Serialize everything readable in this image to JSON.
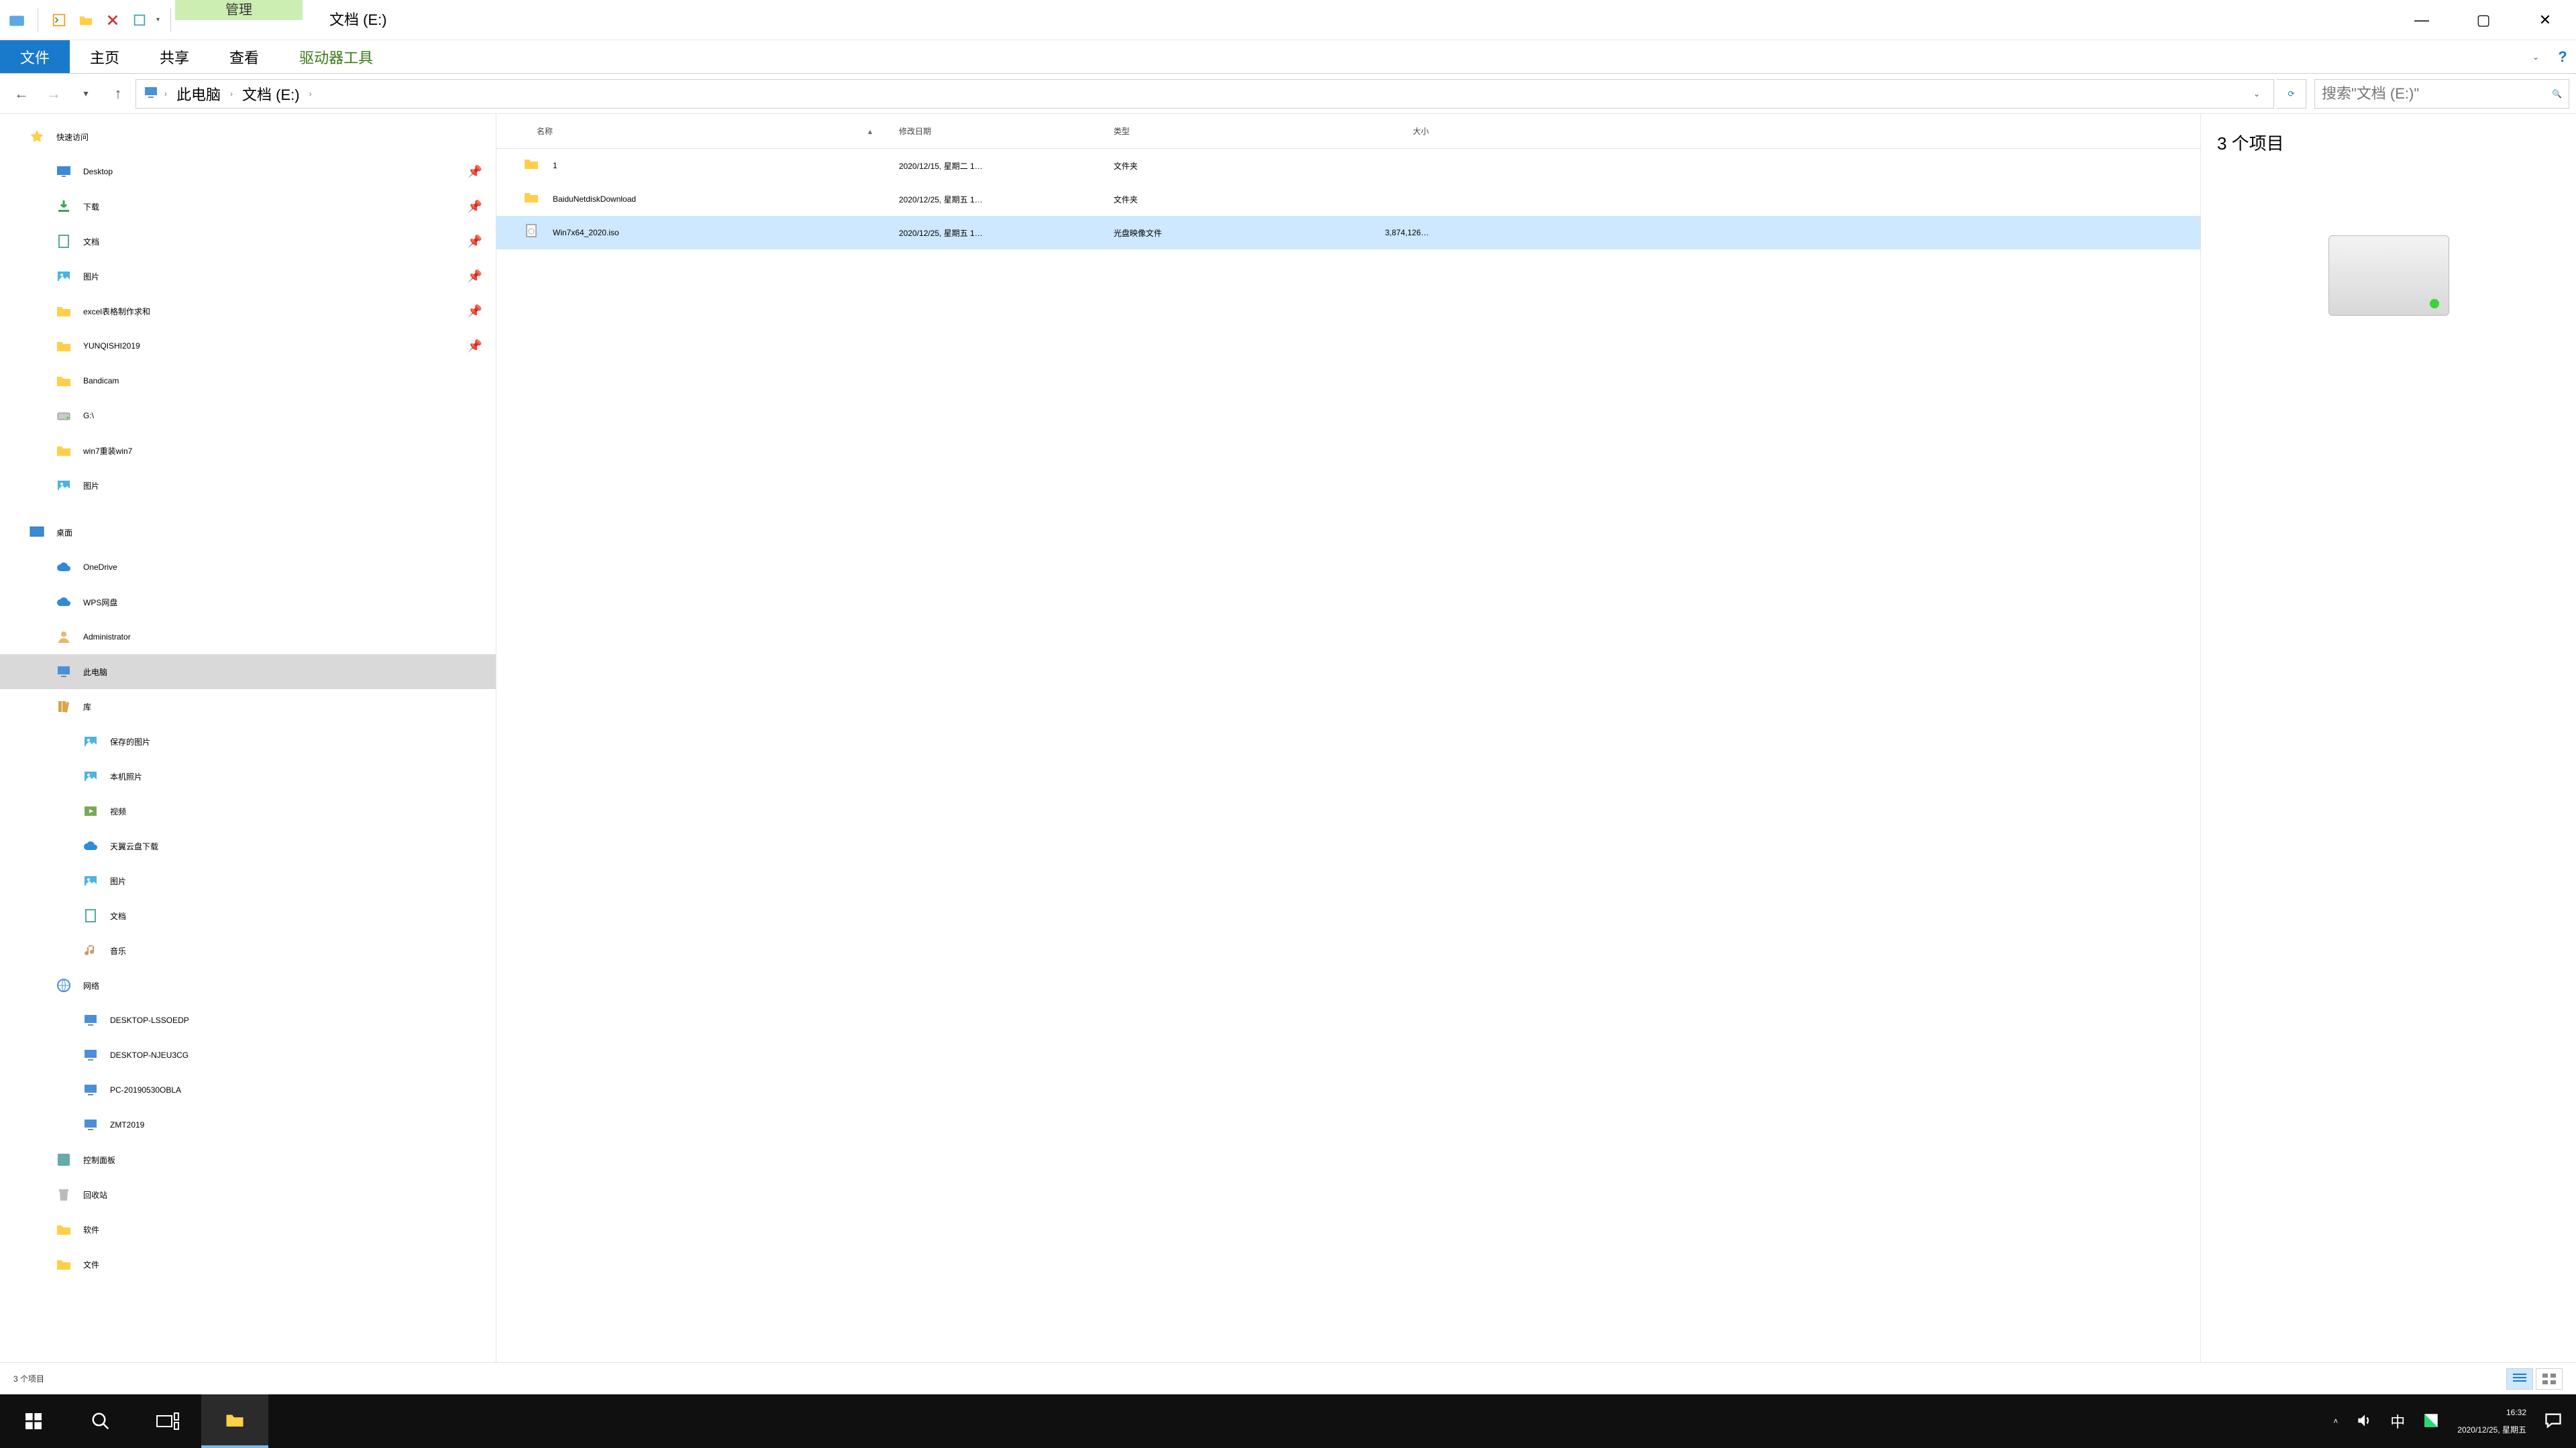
{
  "window": {
    "context_tab": "管理",
    "title": "文档 (E:)",
    "minimize": "—",
    "maximize": "▢",
    "close": "✕"
  },
  "ribbon": {
    "file": "文件",
    "tabs": [
      "主页",
      "共享",
      "查看"
    ],
    "context_tab": "驱动器工具",
    "help": "?"
  },
  "nav": {
    "crumbs": [
      "此电脑",
      "文档 (E:)"
    ],
    "refresh": "⟳"
  },
  "search": {
    "placeholder": "搜索\"文档 (E:)\""
  },
  "tree": {
    "quick_access": "快速访问",
    "quick": [
      {
        "label": "Desktop",
        "pinned": true,
        "icon": "desktop"
      },
      {
        "label": "下载",
        "pinned": true,
        "icon": "download"
      },
      {
        "label": "文档",
        "pinned": true,
        "icon": "doc"
      },
      {
        "label": "图片",
        "pinned": true,
        "icon": "pic"
      },
      {
        "label": "excel表格制作求和",
        "pinned": true,
        "icon": "folder"
      },
      {
        "label": "YUNQISHI2019",
        "pinned": true,
        "icon": "folder"
      },
      {
        "label": "Bandicam",
        "pinned": false,
        "icon": "folder"
      },
      {
        "label": "G:\\",
        "pinned": false,
        "icon": "drive"
      },
      {
        "label": "win7重装win7",
        "pinned": false,
        "icon": "folder"
      },
      {
        "label": "图片",
        "pinned": false,
        "icon": "pic"
      }
    ],
    "desktop": "桌面",
    "desktop_children": [
      {
        "label": "OneDrive",
        "icon": "cloud"
      },
      {
        "label": "WPS网盘",
        "icon": "cloud"
      },
      {
        "label": "Administrator",
        "icon": "user"
      },
      {
        "label": "此电脑",
        "icon": "pc",
        "selected": true
      },
      {
        "label": "库",
        "icon": "lib"
      },
      {
        "label": "保存的图片",
        "icon": "pic",
        "depth": 2
      },
      {
        "label": "本机照片",
        "icon": "pic",
        "depth": 2
      },
      {
        "label": "视频",
        "icon": "video",
        "depth": 2
      },
      {
        "label": "天翼云盘下载",
        "icon": "cloud",
        "depth": 2
      },
      {
        "label": "图片",
        "icon": "pic",
        "depth": 2
      },
      {
        "label": "文档",
        "icon": "doc",
        "depth": 2
      },
      {
        "label": "音乐",
        "icon": "music",
        "depth": 2
      },
      {
        "label": "网络",
        "icon": "net"
      },
      {
        "label": "DESKTOP-LSSOEDP",
        "icon": "pc",
        "depth": 2
      },
      {
        "label": "DESKTOP-NJEU3CG",
        "icon": "pc",
        "depth": 2
      },
      {
        "label": "PC-20190530OBLA",
        "icon": "pc",
        "depth": 2
      },
      {
        "label": "ZMT2019",
        "icon": "pc",
        "depth": 2
      },
      {
        "label": "控制面板",
        "icon": "ctrl"
      },
      {
        "label": "回收站",
        "icon": "bin"
      },
      {
        "label": "软件",
        "icon": "folder"
      },
      {
        "label": "文件",
        "icon": "folder"
      }
    ]
  },
  "columns": {
    "name": "名称",
    "date": "修改日期",
    "type": "类型",
    "size": "大小"
  },
  "rows": [
    {
      "name": "1",
      "date": "2020/12/15, 星期二 1…",
      "type": "文件夹",
      "size": "",
      "icon": "folder",
      "selected": false
    },
    {
      "name": "BaiduNetdiskDownload",
      "date": "2020/12/25, 星期五 1…",
      "type": "文件夹",
      "size": "",
      "icon": "folder",
      "selected": false
    },
    {
      "name": "Win7x64_2020.iso",
      "date": "2020/12/25, 星期五 1…",
      "type": "光盘映像文件",
      "size": "3,874,126…",
      "icon": "iso",
      "selected": true
    }
  ],
  "preview": {
    "count": "3 个项目"
  },
  "status": {
    "text": "3 个项目"
  },
  "taskbar": {
    "time": "16:32",
    "date": "2020/12/25, 星期五",
    "ime": "中"
  }
}
